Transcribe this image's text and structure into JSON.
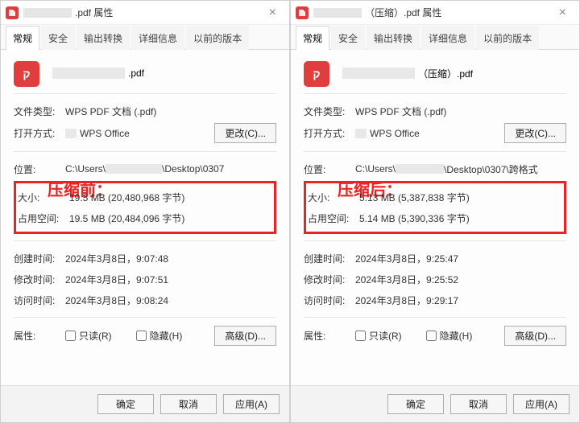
{
  "left": {
    "title_suffix": ".pdf 属性",
    "annot": "压缩前：",
    "tabs": [
      "常规",
      "安全",
      "输出转换",
      "详细信息",
      "以前的版本"
    ],
    "active_tab": 0,
    "filename_suffix": ".pdf",
    "labels": {
      "type": "文件类型:",
      "open": "打开方式:",
      "loc": "位置:",
      "size": "大小:",
      "used": "占用空间:",
      "created": "创建时间:",
      "modified": "修改时间:",
      "accessed": "访问时间:",
      "attr": "属性:"
    },
    "vals": {
      "type": "WPS PDF 文档 (.pdf)",
      "open": "WPS Office",
      "loc_prefix": "C:\\Users\\",
      "loc_suffix": "\\Desktop\\0307",
      "size": "19.5 MB (20,480,968 字节)",
      "used": "19.5 MB (20,484,096 字节)",
      "created": "2024年3月8日，9:07:48",
      "modified": "2024年3月8日，9:07:51",
      "accessed": "2024年3月8日，9:08:24"
    },
    "change_btn": "更改(C)...",
    "readonly": "只读(R)",
    "hidden": "隐藏(H)",
    "advanced": "高级(D)...",
    "ok": "确定",
    "cancel": "取消",
    "apply": "应用(A)"
  },
  "right": {
    "title_suffix": "（压缩）.pdf 属性",
    "annot": "压缩后：",
    "tabs": [
      "常规",
      "安全",
      "输出转换",
      "详细信息",
      "以前的版本"
    ],
    "active_tab": 0,
    "filename_suffix": "（压缩）.pdf",
    "labels": {
      "type": "文件类型:",
      "open": "打开方式:",
      "loc": "位置:",
      "size": "大小:",
      "used": "占用空间:",
      "created": "创建时间:",
      "modified": "修改时间:",
      "accessed": "访问时间:",
      "attr": "属性:"
    },
    "vals": {
      "type": "WPS PDF 文档 (.pdf)",
      "open": "WPS Office",
      "loc_prefix": "C:\\Users\\",
      "loc_suffix": "\\Desktop\\0307\\跨格式",
      "size": "5.13 MB (5,387,838 字节)",
      "used": "5.14 MB (5,390,336 字节)",
      "created": "2024年3月8日，9:25:47",
      "modified": "2024年3月8日，9:25:52",
      "accessed": "2024年3月8日，9:29:17"
    },
    "change_btn": "更改(C)...",
    "readonly": "只读(R)",
    "hidden": "隐藏(H)",
    "advanced": "高级(D)...",
    "ok": "确定",
    "cancel": "取消",
    "apply": "应用(A)"
  }
}
